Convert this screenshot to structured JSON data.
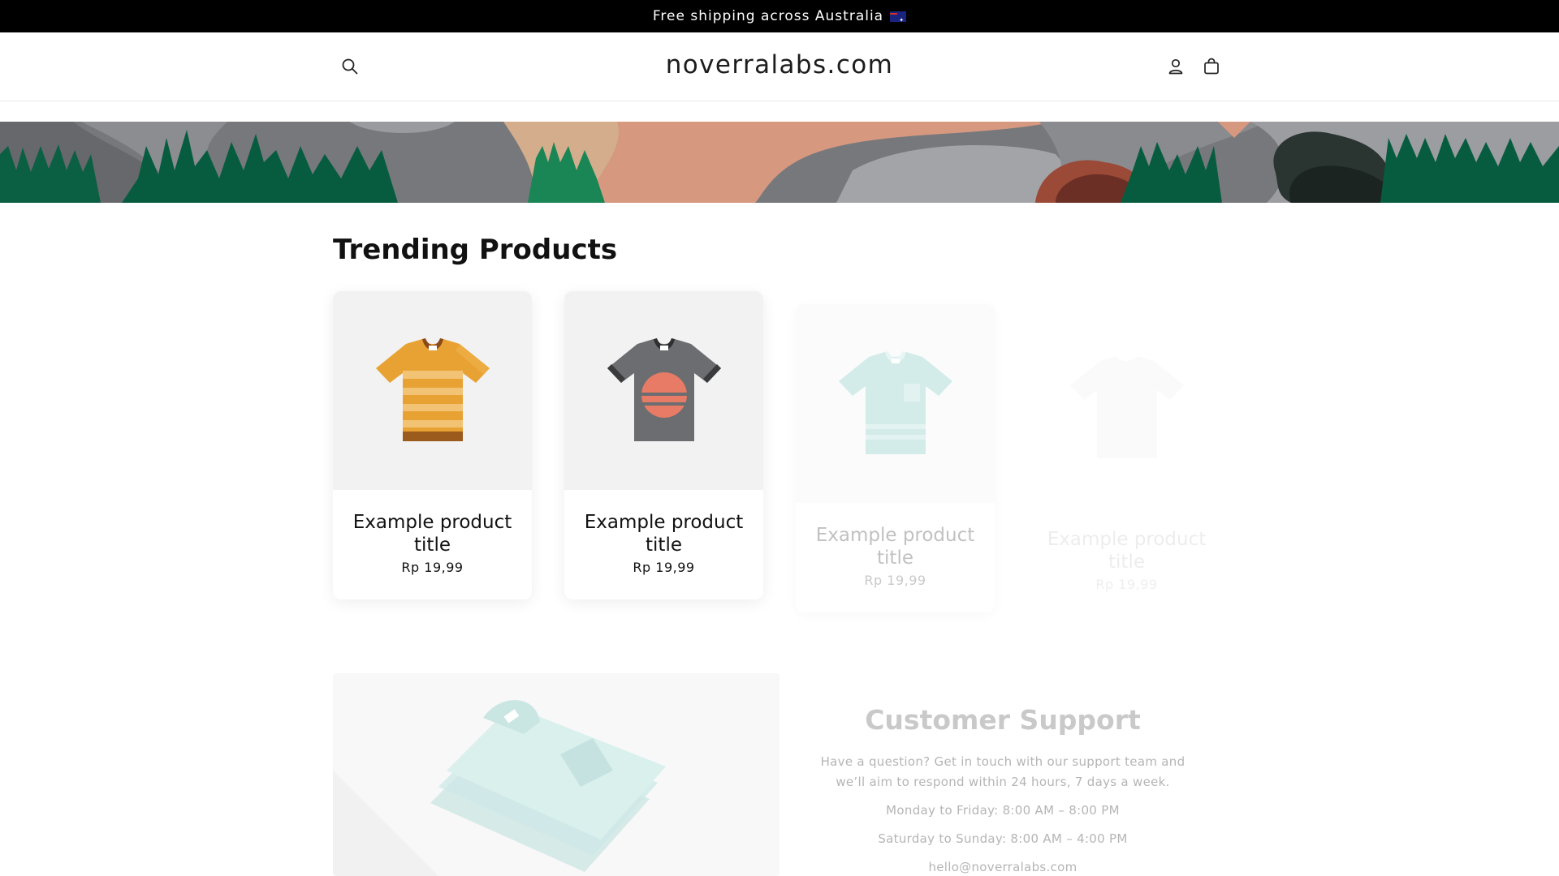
{
  "announcement": {
    "text": "Free shipping across Australia"
  },
  "header": {
    "logo": "noverralabs.com"
  },
  "trending": {
    "title": "Trending Products",
    "products": [
      {
        "title": "Example product title",
        "price": "Rp 19,99"
      },
      {
        "title": "Example product title",
        "price": "Rp 19,99"
      },
      {
        "title": "Example product title",
        "price": "Rp 19,99"
      },
      {
        "title": "Example product title",
        "price": "Rp 19,99"
      }
    ]
  },
  "support": {
    "title": "Customer Support",
    "line1": "Have a question? Get in touch with our support team and",
    "line2": "we’ll aim to respond within 24 hours, 7 days a week.",
    "weekday": "Monday to Friday: 8:00 AM – 8:00 PM",
    "weekend": "Saturday to Sunday: 8:00 AM – 4:00 PM",
    "email": "hello@noverralabs.com"
  },
  "colors": {
    "accent_green": "#0b6b48",
    "terracotta": "#d89880",
    "announce_bg": "#000000"
  }
}
